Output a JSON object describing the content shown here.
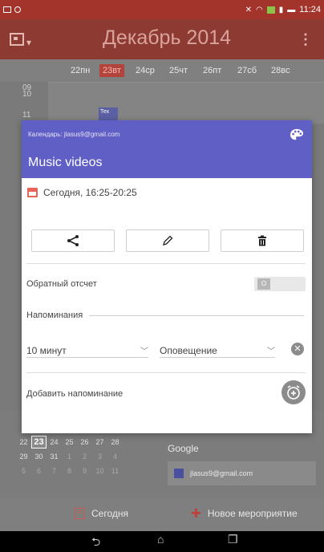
{
  "status_bar": {
    "time": "11:24"
  },
  "app_bar": {
    "title": "Декабрь 2014"
  },
  "week_days": [
    {
      "label": "22пн",
      "today": false
    },
    {
      "label": "23вт",
      "today": true
    },
    {
      "label": "24ср",
      "today": false
    },
    {
      "label": "25чт",
      "today": false
    },
    {
      "label": "26пт",
      "today": false
    },
    {
      "label": "27сб",
      "today": false
    },
    {
      "label": "28вс",
      "today": false
    }
  ],
  "time_labels": [
    "09",
    "10",
    "11"
  ],
  "mini_event_label": "Тех",
  "dialog": {
    "calendar_account": "Календарь: jlasus9@gmail.com",
    "event_title": "Music videos",
    "date_time": "Сегодня, 16:25-20:25",
    "countdown_label": "Обратный отсчет",
    "countdown_toggle_text": "O",
    "reminders_heading": "Напоминания",
    "reminder": {
      "time_value": "10 минут",
      "method_value": "Оповещение"
    },
    "add_reminder_label": "Добавить напоминание"
  },
  "mini_month": [
    [
      "22",
      "23",
      "24",
      "25",
      "26",
      "27",
      "28"
    ],
    [
      "29",
      "30",
      "31",
      "1",
      "2",
      "3",
      "4"
    ],
    [
      "5",
      "6",
      "7",
      "8",
      "9",
      "10",
      "11"
    ]
  ],
  "google_section": {
    "label": "Google",
    "account": "jlasus9@gmail.com"
  },
  "bottom_bar": {
    "today_label": "Сегодня",
    "new_event_label": "Новое мероприятие"
  },
  "colors": {
    "app_bar": "#8d3a33",
    "dialog_header": "#5f5fc6",
    "accent_red": "#ea6357"
  }
}
